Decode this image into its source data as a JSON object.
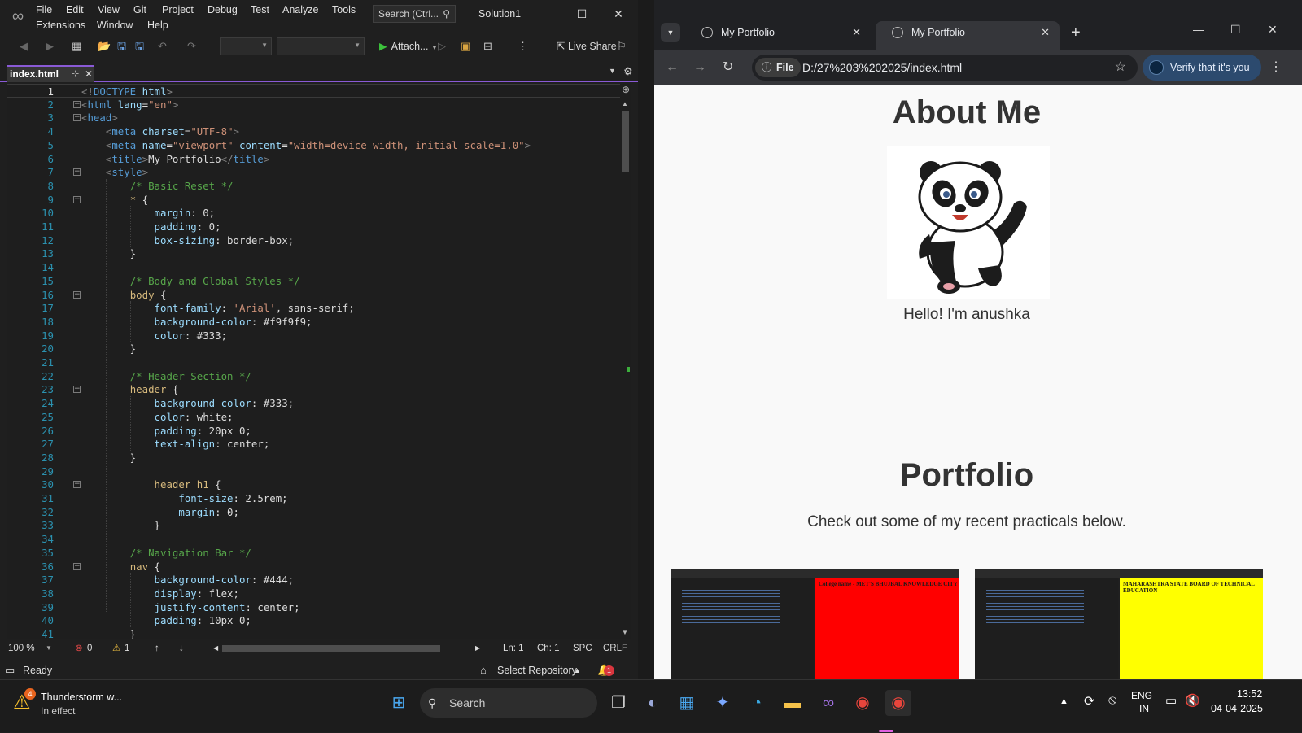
{
  "vs": {
    "menu": [
      "File",
      "Edit",
      "View",
      "Git",
      "Project",
      "Debug",
      "Test",
      "Analyze",
      "Tools",
      "Extensions",
      "Window",
      "Help"
    ],
    "search_placeholder": "Search (Ctrl...",
    "solution_name": "Solution1",
    "attach_label": "Attach...",
    "live_share_label": "Live Share",
    "tab_title": "index.html",
    "code_lines": [
      [
        [
          "t-gray",
          "<!"
        ],
        [
          "t-tag",
          "DOCTYPE "
        ],
        [
          "t-attr",
          "html"
        ],
        [
          "t-gray",
          ">"
        ]
      ],
      [
        [
          "t-gray",
          "<"
        ],
        [
          "t-tag",
          "html "
        ],
        [
          "t-attr",
          "lang"
        ],
        [
          "t-txt",
          "="
        ],
        [
          "t-str",
          "\"en\""
        ],
        [
          "t-gray",
          ">"
        ]
      ],
      [
        [
          "t-gray",
          "<"
        ],
        [
          "t-tag",
          "head"
        ],
        [
          "t-gray",
          ">"
        ]
      ],
      [
        [
          "t-txt",
          "    "
        ],
        [
          "t-gray",
          "<"
        ],
        [
          "t-tag",
          "meta "
        ],
        [
          "t-attr",
          "charset"
        ],
        [
          "t-txt",
          "="
        ],
        [
          "t-str",
          "\"UTF-8\""
        ],
        [
          "t-gray",
          ">"
        ]
      ],
      [
        [
          "t-txt",
          "    "
        ],
        [
          "t-gray",
          "<"
        ],
        [
          "t-tag",
          "meta "
        ],
        [
          "t-attr",
          "name"
        ],
        [
          "t-txt",
          "="
        ],
        [
          "t-str",
          "\"viewport\" "
        ],
        [
          "t-attr",
          "content"
        ],
        [
          "t-txt",
          "="
        ],
        [
          "t-str",
          "\"width=device-width, initial-scale=1.0\""
        ],
        [
          "t-gray",
          ">"
        ]
      ],
      [
        [
          "t-txt",
          "    "
        ],
        [
          "t-gray",
          "<"
        ],
        [
          "t-tag",
          "title"
        ],
        [
          "t-gray",
          ">"
        ],
        [
          "t-txt",
          "My Portfolio"
        ],
        [
          "t-gray",
          "</"
        ],
        [
          "t-tag",
          "title"
        ],
        [
          "t-gray",
          ">"
        ]
      ],
      [
        [
          "t-txt",
          "    "
        ],
        [
          "t-gray",
          "<"
        ],
        [
          "t-tag",
          "style"
        ],
        [
          "t-gray",
          ">"
        ]
      ],
      [
        [
          "t-txt",
          "        "
        ],
        [
          "t-cmt",
          "/* Basic Reset */"
        ]
      ],
      [
        [
          "t-txt",
          "        "
        ],
        [
          "t-sel",
          "* "
        ],
        [
          "t-txt",
          "{"
        ]
      ],
      [
        [
          "t-txt",
          "            "
        ],
        [
          "t-prop",
          "margin"
        ],
        [
          "t-txt",
          ": 0;"
        ]
      ],
      [
        [
          "t-txt",
          "            "
        ],
        [
          "t-prop",
          "padding"
        ],
        [
          "t-txt",
          ": 0;"
        ]
      ],
      [
        [
          "t-txt",
          "            "
        ],
        [
          "t-prop",
          "box-sizing"
        ],
        [
          "t-txt",
          ": border-box;"
        ]
      ],
      [
        [
          "t-txt",
          "        }"
        ]
      ],
      [
        [
          "t-txt",
          ""
        ]
      ],
      [
        [
          "t-txt",
          "        "
        ],
        [
          "t-cmt",
          "/* Body and Global Styles */"
        ]
      ],
      [
        [
          "t-txt",
          "        "
        ],
        [
          "t-sel",
          "body "
        ],
        [
          "t-txt",
          "{"
        ]
      ],
      [
        [
          "t-txt",
          "            "
        ],
        [
          "t-prop",
          "font-family"
        ],
        [
          "t-txt",
          ": "
        ],
        [
          "t-str",
          "'Arial'"
        ],
        [
          "t-txt",
          ", sans-serif;"
        ]
      ],
      [
        [
          "t-txt",
          "            "
        ],
        [
          "t-prop",
          "background-color"
        ],
        [
          "t-txt",
          ": #f9f9f9;"
        ]
      ],
      [
        [
          "t-txt",
          "            "
        ],
        [
          "t-prop",
          "color"
        ],
        [
          "t-txt",
          ": #333;"
        ]
      ],
      [
        [
          "t-txt",
          "        }"
        ]
      ],
      [
        [
          "t-txt",
          ""
        ]
      ],
      [
        [
          "t-txt",
          "        "
        ],
        [
          "t-cmt",
          "/* Header Section */"
        ]
      ],
      [
        [
          "t-txt",
          "        "
        ],
        [
          "t-sel",
          "header "
        ],
        [
          "t-txt",
          "{"
        ]
      ],
      [
        [
          "t-txt",
          "            "
        ],
        [
          "t-prop",
          "background-color"
        ],
        [
          "t-txt",
          ": #333;"
        ]
      ],
      [
        [
          "t-txt",
          "            "
        ],
        [
          "t-prop",
          "color"
        ],
        [
          "t-txt",
          ": white;"
        ]
      ],
      [
        [
          "t-txt",
          "            "
        ],
        [
          "t-prop",
          "padding"
        ],
        [
          "t-txt",
          ": 20px 0;"
        ]
      ],
      [
        [
          "t-txt",
          "            "
        ],
        [
          "t-prop",
          "text-align"
        ],
        [
          "t-txt",
          ": center;"
        ]
      ],
      [
        [
          "t-txt",
          "        }"
        ]
      ],
      [
        [
          "t-txt",
          ""
        ]
      ],
      [
        [
          "t-txt",
          "            "
        ],
        [
          "t-sel",
          "header h1 "
        ],
        [
          "t-txt",
          "{"
        ]
      ],
      [
        [
          "t-txt",
          "                "
        ],
        [
          "t-prop",
          "font-size"
        ],
        [
          "t-txt",
          ": 2.5rem;"
        ]
      ],
      [
        [
          "t-txt",
          "                "
        ],
        [
          "t-prop",
          "margin"
        ],
        [
          "t-txt",
          ": 0;"
        ]
      ],
      [
        [
          "t-txt",
          "            }"
        ]
      ],
      [
        [
          "t-txt",
          ""
        ]
      ],
      [
        [
          "t-txt",
          "        "
        ],
        [
          "t-cmt",
          "/* Navigation Bar */"
        ]
      ],
      [
        [
          "t-txt",
          "        "
        ],
        [
          "t-sel",
          "nav "
        ],
        [
          "t-txt",
          "{"
        ]
      ],
      [
        [
          "t-txt",
          "            "
        ],
        [
          "t-prop",
          "background-color"
        ],
        [
          "t-txt",
          ": #444;"
        ]
      ],
      [
        [
          "t-txt",
          "            "
        ],
        [
          "t-prop",
          "display"
        ],
        [
          "t-txt",
          ": flex;"
        ]
      ],
      [
        [
          "t-txt",
          "            "
        ],
        [
          "t-prop",
          "justify-content"
        ],
        [
          "t-txt",
          ": center;"
        ]
      ],
      [
        [
          "t-txt",
          "            "
        ],
        [
          "t-prop",
          "padding"
        ],
        [
          "t-txt",
          ": 10px 0;"
        ]
      ],
      [
        [
          "t-txt",
          "        }"
        ]
      ]
    ],
    "fold_lines": [
      2,
      3,
      7,
      9,
      16,
      23,
      30,
      36
    ],
    "status": {
      "zoom": "100 %",
      "errors": "0",
      "warnings": "1",
      "ln": "Ln: 1",
      "ch": "Ch: 1",
      "spc": "SPC",
      "crlf": "CRLF",
      "ready": "Ready",
      "select_repo": "Select Repository",
      "notif_count": "1"
    }
  },
  "browser": {
    "tabs": [
      "My Portfolio",
      "My Portfolio"
    ],
    "address_chip": "File",
    "url": "D:/27%203%202025/index.html",
    "verify_label": "Verify that it's you",
    "page": {
      "about_title": "About Me",
      "hello": "Hello! I'm anushka",
      "portfolio_title": "Portfolio",
      "practicals_text": "Check out some of my recent practicals below.",
      "card1_text": "College name - MET'S BHUJBAL KNOWLEDGE CITY",
      "card2_text": "MAHARASHTRA STATE BOARD OF TECHNICAL EDUCATION"
    }
  },
  "taskbar": {
    "weather_title": "Thunderstorm w...",
    "weather_sub": "In effect",
    "weather_badge": "4",
    "search_label": "Search",
    "lang1": "ENG",
    "lang2": "IN",
    "time": "13:52",
    "date": "04-04-2025"
  }
}
